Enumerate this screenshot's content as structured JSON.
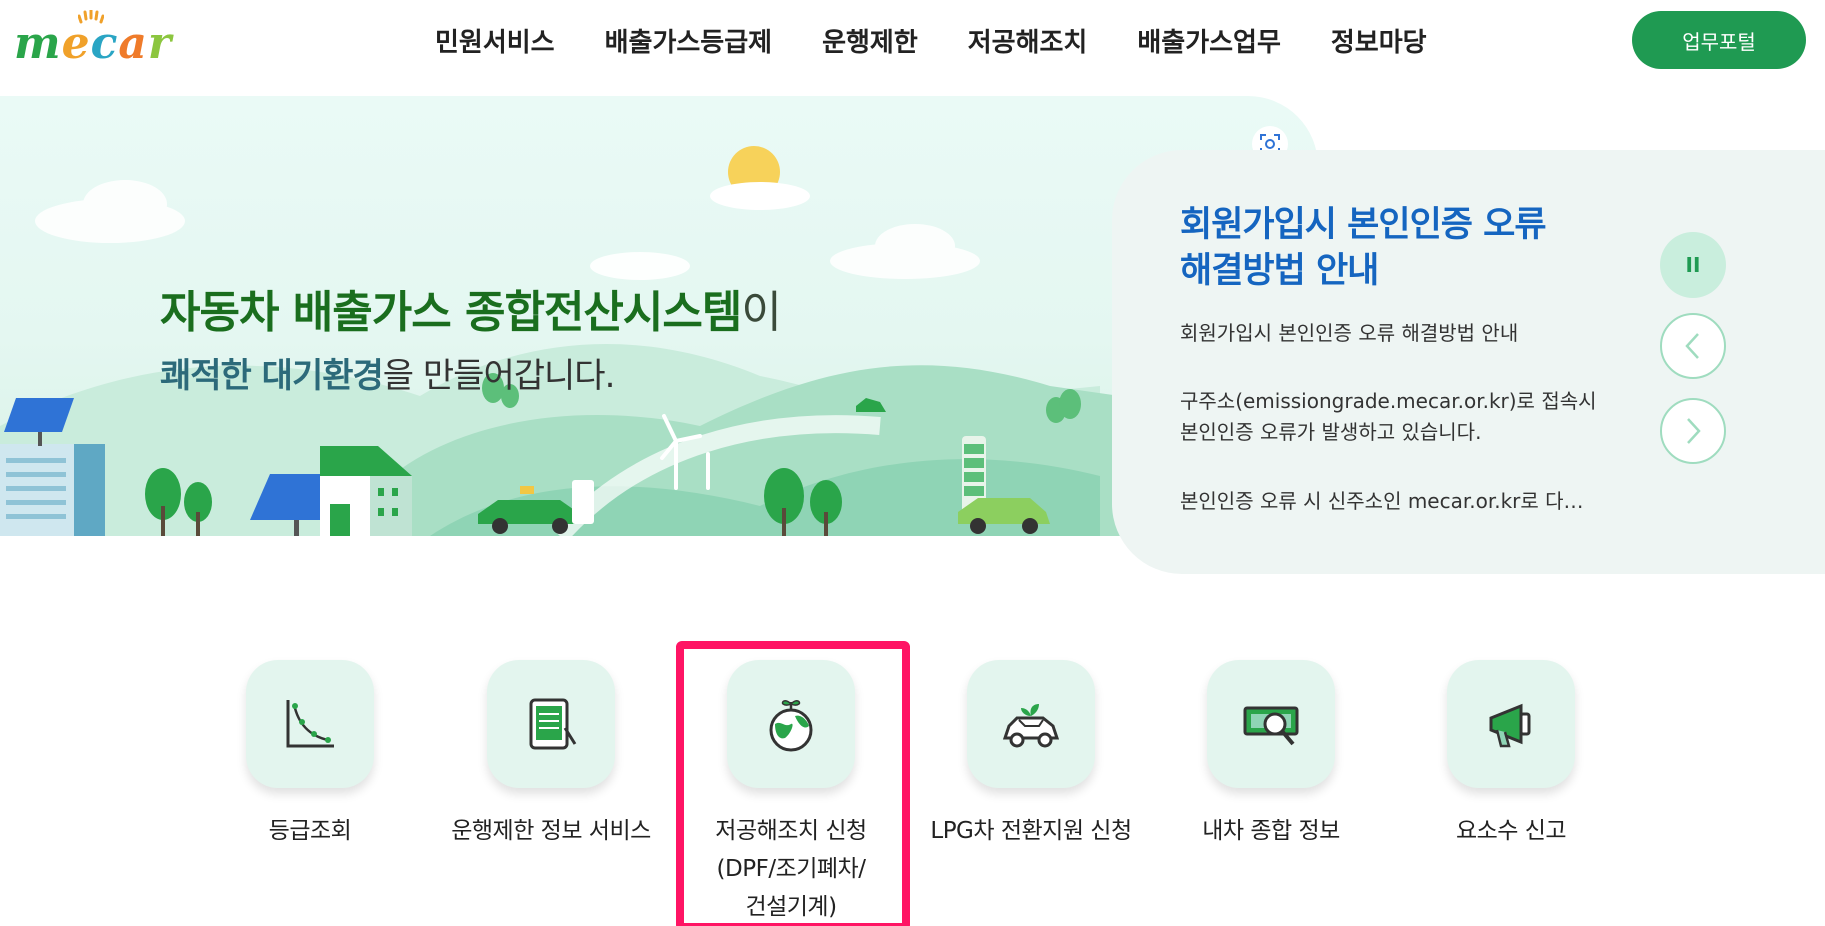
{
  "header": {
    "logo_text": "mecar",
    "nav": [
      "민원서비스",
      "배출가스등급제",
      "운행제한",
      "저공해조치",
      "배출가스업무",
      "정보마당"
    ],
    "portal_button": "업무포털"
  },
  "hero": {
    "title_bold": "자동차 배출가스 종합전산시스템",
    "title_tail": "이",
    "sub_bold": "쾌적한 대기환경",
    "sub_tail": "을 만들어갑니다."
  },
  "notice": {
    "title_line1": "회원가입시 본인인증 오류",
    "title_line2": "해결방법 안내",
    "p1": "회원가입시 본인인증 오류 해결방법 안내",
    "p2_line1": "구주소(emissiongrade.mecar.or.kr)로 접속시",
    "p2_line2": "본인인증 오류가 발생하고 있습니다.",
    "p3": "본인인증 오류 시 신주소인 mecar.or.kr로 다…",
    "pause_glyph": "II"
  },
  "quick_menu": [
    {
      "label": "등급조회",
      "icon": "graph-icon"
    },
    {
      "label": "운행제한 정보 서비스",
      "icon": "tablet-icon"
    },
    {
      "label_lines": [
        "저공해조치 신청",
        "(DPF/조기폐차/",
        "건설기계)"
      ],
      "icon": "earth-sprout-icon"
    },
    {
      "label": "LPG차 전환지원 신청",
      "icon": "eco-car-icon"
    },
    {
      "label": "내차 종합 정보",
      "icon": "money-search-icon"
    },
    {
      "label": "요소수 신고",
      "icon": "megaphone-icon"
    }
  ],
  "colors": {
    "brand_green": "#1f9a52",
    "notice_title": "#1565c0",
    "highlight_border": "#ff1464"
  }
}
